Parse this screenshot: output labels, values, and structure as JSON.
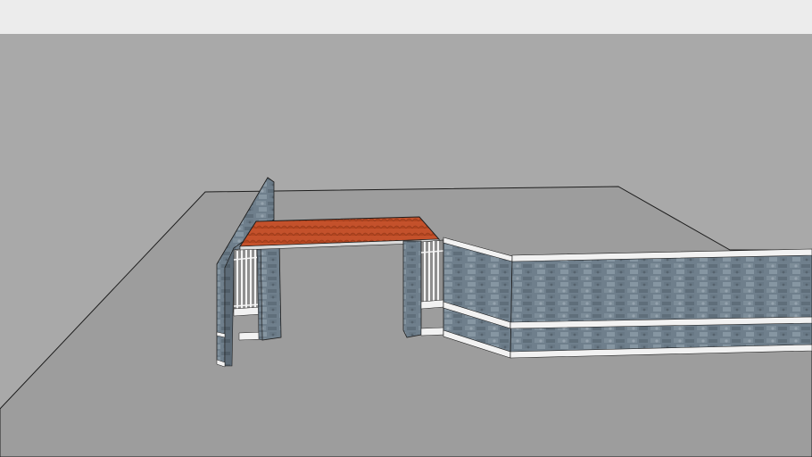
{
  "viewport": {
    "mode": "3d-model-view",
    "sky_color": "#ececec",
    "ground_color": "#a9a9a9",
    "ground_plane_color": "#9d9d9d"
  },
  "model": {
    "roof_color": "#c4512b",
    "stone_color": "#6f7f8c",
    "trim_color": "#f2f2f2",
    "gate_bar_color": "#f4f4f4",
    "edge_color": "#1e1e1e"
  }
}
